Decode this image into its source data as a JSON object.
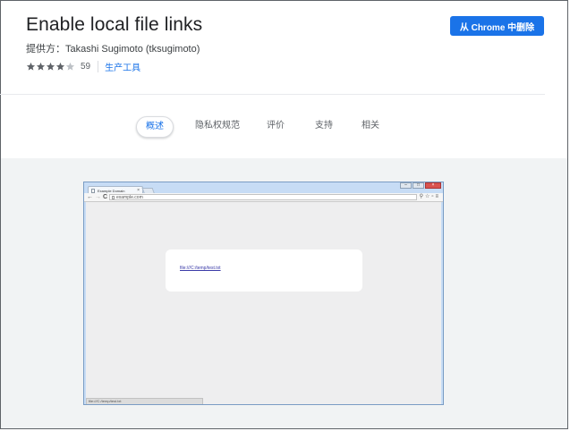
{
  "header": {
    "title": "Enable local file links",
    "provider": "提供方：Takashi Sugimoto (tksugimoto)",
    "rating": 4,
    "rating_count": "59",
    "category": "生产工具",
    "remove_label": "从 Chrome 中删除"
  },
  "tabs": [
    {
      "label": "概述",
      "active": true
    },
    {
      "label": "隐私权规范",
      "active": false
    },
    {
      "label": "评价",
      "active": false
    },
    {
      "label": "支持",
      "active": false
    },
    {
      "label": "相关",
      "active": false
    }
  ],
  "screenshot": {
    "tab_title": "Example Domain",
    "tab_close": "×",
    "url": "example.com",
    "link_text": "file:///C:/temp/test.txt",
    "status_text": "file:///C:/temp/test.txt",
    "nav_back": "←",
    "nav_forward": "→",
    "nav_reload": "C",
    "toolbar_icons": "⚲☆▫≡",
    "win_minimize": "–",
    "win_maximize": "□",
    "win_close": "×"
  },
  "colors": {
    "accent": "#1a73e8",
    "star_filled": "#5f6368",
    "star_empty": "#bdc1c6",
    "gallery_bg": "#f1f3f4"
  }
}
